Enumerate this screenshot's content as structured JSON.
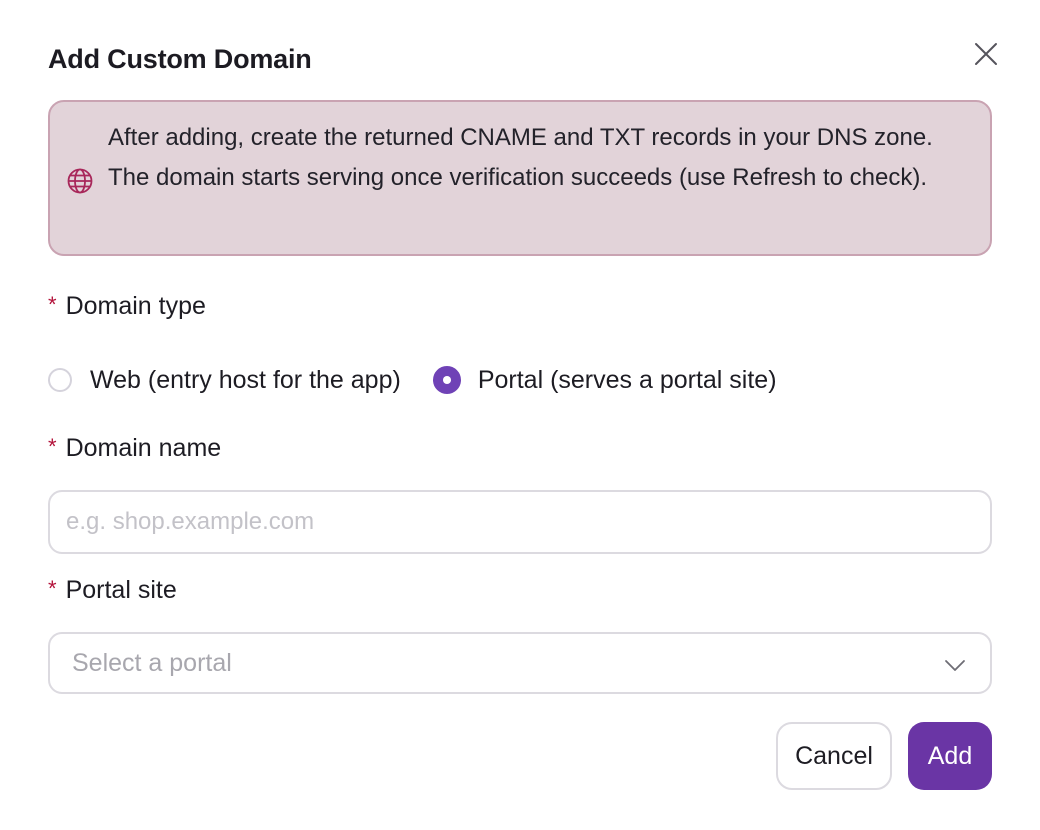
{
  "dialog": {
    "title": "Add Custom Domain",
    "close_icon": "close-icon"
  },
  "notice": {
    "icon": "globe-icon",
    "text": "After adding, create the returned CNAME and TXT records in your DNS zone. The domain starts serving once verification succeeds (use Refresh to check)."
  },
  "form": {
    "required_mark": "*",
    "domain_type": {
      "label": "Domain type",
      "options": [
        {
          "label": "Web (entry host for the app)",
          "checked": false
        },
        {
          "label": "Portal (serves a portal site)",
          "checked": true
        }
      ]
    },
    "domain_name": {
      "label": "Domain name",
      "value": "",
      "placeholder": "e.g. shop.example.com"
    },
    "portal_site": {
      "label": "Portal site",
      "placeholder": "Select a portal",
      "chevron_icon": "chevron-down-icon"
    }
  },
  "actions": {
    "cancel_label": "Cancel",
    "add_label": "Add"
  },
  "colors": {
    "accent": "#6a35a5",
    "notice_bg": "#e2d3d9",
    "notice_border": "#c9a3b2",
    "required": "#b3123a"
  }
}
